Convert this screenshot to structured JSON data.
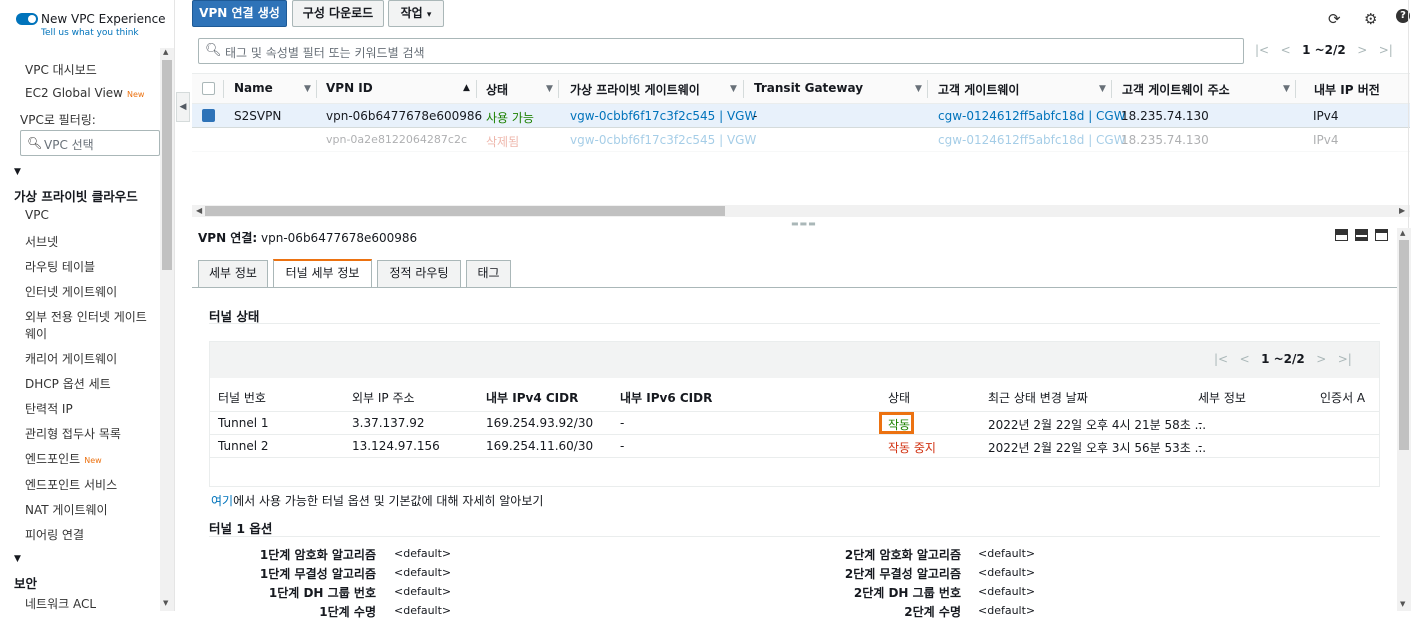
{
  "sidebar": {
    "experience_title": "New VPC Experience",
    "experience_sub": "Tell us what you think",
    "links_top": [
      {
        "label": "VPC 대시보드",
        "new": ""
      },
      {
        "label": "EC2 Global View",
        "new": "New"
      }
    ],
    "filter_label": "VPC로 필터링:",
    "filter_placeholder": "VPC 선택",
    "section1": "가상 프라이빗 클라우드",
    "section1_items": [
      "VPC",
      "서브넷",
      "라우팅 테이블",
      "인터넷 게이트웨이",
      "외부 전용 인터넷 게이트",
      "웨이",
      "캐리어 게이트웨이",
      "DHCP 옵션 세트",
      "탄력적 IP",
      "관리형 접두사 목록",
      "엔드포인트",
      "엔드포인트 서비스",
      "NAT 게이트웨이",
      "피어링 연결"
    ],
    "new_badge": "New",
    "section2": "보안",
    "section2_items": [
      "네트워크 ACL"
    ]
  },
  "toolbar": {
    "create_label": "VPN 연결 생성",
    "download_label": "구성 다운로드",
    "actions_label": "작업"
  },
  "search": {
    "placeholder": "태그 및 속성별 필터 또는 키워드별 검색"
  },
  "pager_top": "1 ~2/2",
  "grid": {
    "columns": [
      "Name",
      "VPN ID",
      "상태",
      "가상 프라이빗 게이트웨이",
      "Transit Gateway",
      "고객 게이트웨이",
      "고객 게이트웨이 주소",
      "내부 IP 버전"
    ],
    "rows": [
      {
        "name": "S2SVPN",
        "vpn_id": "vpn-06b6477678e600986",
        "state": "사용 가능",
        "vgw": "vgw-0cbbf6f17c3f2c545 | VGW",
        "tgw": "-",
        "cgw": "cgw-0124612ff5abfc18d | CGW",
        "cgw_addr": "18.235.74.130",
        "ip_ver": "IPv4"
      },
      {
        "name": "",
        "vpn_id": "vpn-0a2e8122064287c2c",
        "state": "삭제됨",
        "vgw": "vgw-0cbbf6f17c3f2c545 | VGW",
        "tgw": "",
        "cgw": "cgw-0124612ff5abfc18d | CGW",
        "cgw_addr": "18.235.74.130",
        "ip_ver": "IPv4"
      }
    ]
  },
  "detail": {
    "title_prefix": "VPN 연결:",
    "title_id": "vpn-06b6477678e600986",
    "tabs": [
      "세부 정보",
      "터널 세부 정보",
      "정적 라우팅",
      "태그"
    ],
    "tunnel_state_heading": "터널 상태",
    "pager": "1 ~2/2",
    "tunnel_columns": [
      "터널 번호",
      "외부 IP 주소",
      "내부 IPv4 CIDR",
      "내부 IPv6 CIDR",
      "상태",
      "최근 상태 변경 날짜",
      "세부 정보",
      "인증서 A"
    ],
    "tunnels": [
      {
        "num": "Tunnel 1",
        "outside_ip": "3.37.137.92",
        "cidr4": "169.254.93.92/30",
        "cidr6": "-",
        "status": "작동",
        "changed": "2022년 2월 22일 오후 4시 21분 58초 ...",
        "details": "-"
      },
      {
        "num": "Tunnel 2",
        "outside_ip": "13.124.97.156",
        "cidr4": "169.254.11.60/30",
        "cidr6": "-",
        "status": "작동 중지",
        "changed": "2022년 2월 22일 오후 3시 56분 53초 ...",
        "details": "-"
      }
    ],
    "learn_link": "여기",
    "learn_text": "에서 사용 가능한 터널 옵션 및 기본값에 대해 자세히 알아보기",
    "options_heading": "터널 1 옵션",
    "options_left": [
      {
        "label": "1단계 암호화 알고리즘",
        "value": "<default>"
      },
      {
        "label": "1단계 무결성 알고리즘",
        "value": "<default>"
      },
      {
        "label": "1단계 DH 그룹 번호",
        "value": "<default>"
      },
      {
        "label": "1단계 수명",
        "value": "<default>"
      }
    ],
    "options_right": [
      {
        "label": "2단계 암호화 알고리즘",
        "value": "<default>"
      },
      {
        "label": "2단계 무결성 알고리즘",
        "value": "<default>"
      },
      {
        "label": "2단계 DH 그룹 번호",
        "value": "<default>"
      },
      {
        "label": "2단계 수명",
        "value": "<default>"
      }
    ]
  },
  "colors": {
    "accent": "#ec7211",
    "primary": "#2e73b8",
    "link": "#0073bb",
    "ok": "#1d8102",
    "err": "#d13212"
  }
}
